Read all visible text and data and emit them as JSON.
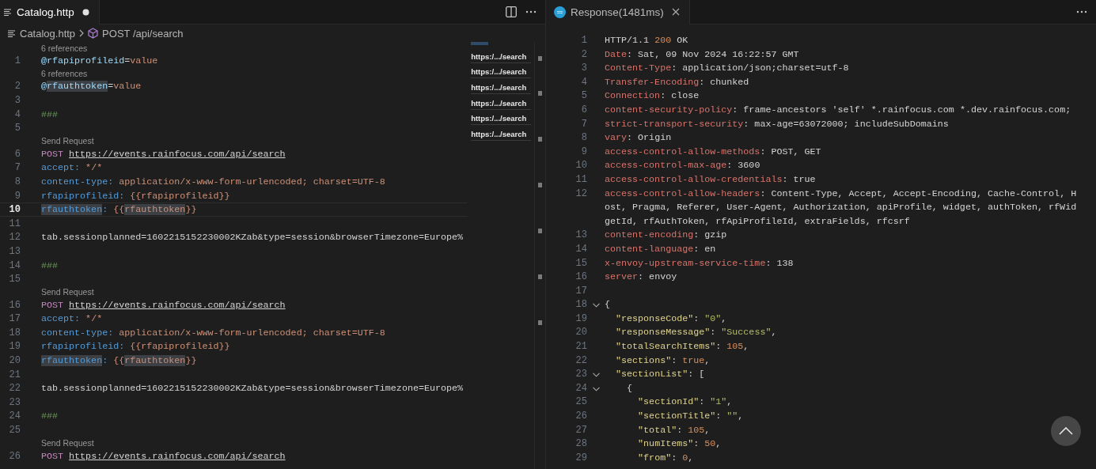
{
  "editor": {
    "tab": {
      "title": "Catalog.http",
      "modified": true
    },
    "breadcrumb": {
      "file": "Catalog.http",
      "symbol": "POST /api/search"
    },
    "lines": [
      {
        "kind": "lens",
        "text": "6 references"
      },
      {
        "kind": "code",
        "no": "1",
        "current": false,
        "tokens": [
          {
            "text": "@rfapiprofileid",
            "kind": "var"
          },
          {
            "text": "=",
            "kind": "plain"
          },
          {
            "text": "value",
            "kind": "val"
          }
        ]
      },
      {
        "kind": "lens",
        "text": "6 references"
      },
      {
        "kind": "code",
        "no": "2",
        "current": false,
        "tokens": [
          {
            "text": "@",
            "kind": "var"
          },
          {
            "text": "rfauthtoken",
            "kind": "var-hl"
          },
          {
            "text": "=",
            "kind": "plain"
          },
          {
            "text": "value",
            "kind": "val"
          }
        ]
      },
      {
        "kind": "code",
        "no": "3",
        "current": false
      },
      {
        "kind": "code",
        "no": "4",
        "current": false,
        "tokens": [
          {
            "text": "###",
            "kind": "comment"
          }
        ]
      },
      {
        "kind": "code",
        "no": "5",
        "current": false
      },
      {
        "kind": "lens",
        "text": "Send Request"
      },
      {
        "kind": "code",
        "no": "6",
        "current": false,
        "tokens": [
          {
            "text": "POST ",
            "kind": "method"
          },
          {
            "text": "https://events.rainfocus.com/api/search",
            "kind": "link"
          }
        ]
      },
      {
        "kind": "code",
        "no": "7",
        "current": false,
        "tokens": [
          {
            "text": "accept:",
            "kind": "header"
          },
          {
            "text": " */*",
            "kind": "val"
          }
        ]
      },
      {
        "kind": "code",
        "no": "8",
        "current": false,
        "tokens": [
          {
            "text": "content-type:",
            "kind": "header"
          },
          {
            "text": " application/x-www-form-urlencoded; charset=UTF-8",
            "kind": "val"
          }
        ]
      },
      {
        "kind": "code",
        "no": "9",
        "current": false,
        "tokens": [
          {
            "text": "rfapiprofileid:",
            "kind": "header"
          },
          {
            "text": " {{rfapiprofileid}}",
            "kind": "val"
          }
        ]
      },
      {
        "kind": "code",
        "no": "10",
        "current": true,
        "tokens": [
          {
            "text": "rfauthtoken",
            "kind": "header-hl"
          },
          {
            "text": ":",
            "kind": "header"
          },
          {
            "text": " {{",
            "kind": "val"
          },
          {
            "text": "rfauthtoken",
            "kind": "val-hl"
          },
          {
            "text": "}}",
            "kind": "val"
          }
        ]
      },
      {
        "kind": "code",
        "no": "11",
        "current": false
      },
      {
        "kind": "code",
        "no": "12",
        "current": false,
        "tokens": [
          {
            "text": "tab.sessionplanned=1602215152230002KZab&type=session&browserTimezone=Europe%",
            "kind": "plain"
          }
        ]
      },
      {
        "kind": "code",
        "no": "13",
        "current": false
      },
      {
        "kind": "code",
        "no": "14",
        "current": false,
        "tokens": [
          {
            "text": "###",
            "kind": "comment"
          }
        ]
      },
      {
        "kind": "code",
        "no": "15",
        "current": false
      },
      {
        "kind": "lens",
        "text": "Send Request"
      },
      {
        "kind": "code",
        "no": "16",
        "current": false,
        "tokens": [
          {
            "text": "POST ",
            "kind": "method"
          },
          {
            "text": "https://events.rainfocus.com/api/search",
            "kind": "link"
          }
        ]
      },
      {
        "kind": "code",
        "no": "17",
        "current": false,
        "tokens": [
          {
            "text": "accept:",
            "kind": "header"
          },
          {
            "text": " */*",
            "kind": "val"
          }
        ]
      },
      {
        "kind": "code",
        "no": "18",
        "current": false,
        "tokens": [
          {
            "text": "content-type:",
            "kind": "header"
          },
          {
            "text": " application/x-www-form-urlencoded; charset=UTF-8",
            "kind": "val"
          }
        ]
      },
      {
        "kind": "code",
        "no": "19",
        "current": false,
        "tokens": [
          {
            "text": "rfapiprofileid:",
            "kind": "header"
          },
          {
            "text": " {{rfapiprofileid}}",
            "kind": "val"
          }
        ]
      },
      {
        "kind": "code",
        "no": "20",
        "current": false,
        "tokens": [
          {
            "text": "rfauthtoken",
            "kind": "header-hl"
          },
          {
            "text": ":",
            "kind": "header"
          },
          {
            "text": " {{",
            "kind": "val"
          },
          {
            "text": "rfauthtoken",
            "kind": "val-hl"
          },
          {
            "text": "}}",
            "kind": "val"
          }
        ]
      },
      {
        "kind": "code",
        "no": "21",
        "current": false
      },
      {
        "kind": "code",
        "no": "22",
        "current": false,
        "tokens": [
          {
            "text": "tab.sessionplanned=1602215152230002KZab&type=session&browserTimezone=Europe%",
            "kind": "plain"
          }
        ]
      },
      {
        "kind": "code",
        "no": "23",
        "current": false
      },
      {
        "kind": "code",
        "no": "24",
        "current": false,
        "tokens": [
          {
            "text": "###",
            "kind": "comment"
          }
        ]
      },
      {
        "kind": "code",
        "no": "25",
        "current": false
      },
      {
        "kind": "lens",
        "text": "Send Request"
      },
      {
        "kind": "code",
        "no": "26",
        "current": false,
        "tokens": [
          {
            "text": "POST ",
            "kind": "method"
          },
          {
            "text": "https://events.rainfocus.com/api/search",
            "kind": "link"
          }
        ]
      }
    ],
    "minimap": {
      "labels": [
        "https:/.../search",
        "https:/.../search",
        "https:/.../search",
        "https:/.../search",
        "https:/.../search",
        "https:/.../search"
      ]
    }
  },
  "response": {
    "tab": {
      "title": "Response(1481ms)"
    },
    "lines": [
      {
        "no": "1",
        "fold": false,
        "tokens": [
          {
            "text": "HTTP/1.1 ",
            "kind": "plain"
          },
          {
            "text": "200",
            "kind": "num"
          },
          {
            "text": " OK",
            "kind": "plain"
          }
        ]
      },
      {
        "no": "2",
        "fold": false,
        "tokens": [
          {
            "text": "Date",
            "kind": "hname"
          },
          {
            "text": ": Sat, 09 Nov 2024 16:22:57 GMT",
            "kind": "plain"
          }
        ]
      },
      {
        "no": "3",
        "fold": false,
        "tokens": [
          {
            "text": "Content-Type",
            "kind": "hname"
          },
          {
            "text": ": application/json;charset=utf-8",
            "kind": "plain"
          }
        ]
      },
      {
        "no": "4",
        "fold": false,
        "tokens": [
          {
            "text": "Transfer-Encoding",
            "kind": "hname"
          },
          {
            "text": ": chunked",
            "kind": "plain"
          }
        ]
      },
      {
        "no": "5",
        "fold": false,
        "tokens": [
          {
            "text": "Connection",
            "kind": "hname"
          },
          {
            "text": ": close",
            "kind": "plain"
          }
        ]
      },
      {
        "no": "6",
        "fold": false,
        "tokens": [
          {
            "text": "content-security-policy",
            "kind": "hname"
          },
          {
            "text": ": frame-ancestors 'self' *.rainfocus.com *.dev.rainfocus.com;",
            "kind": "plain"
          }
        ]
      },
      {
        "no": "7",
        "fold": false,
        "tokens": [
          {
            "text": "strict-transport-security",
            "kind": "hname"
          },
          {
            "text": ": max-age=63072000; includeSubDomains",
            "kind": "plain"
          }
        ]
      },
      {
        "no": "8",
        "fold": false,
        "tokens": [
          {
            "text": "vary",
            "kind": "hname"
          },
          {
            "text": ": Origin",
            "kind": "plain"
          }
        ]
      },
      {
        "no": "9",
        "fold": false,
        "tokens": [
          {
            "text": "access-control-allow-methods",
            "kind": "hname"
          },
          {
            "text": ": POST, GET",
            "kind": "plain"
          }
        ]
      },
      {
        "no": "10",
        "fold": false,
        "tokens": [
          {
            "text": "access-control-max-age",
            "kind": "hname"
          },
          {
            "text": ": 3600",
            "kind": "plain"
          }
        ]
      },
      {
        "no": "11",
        "fold": false,
        "tokens": [
          {
            "text": "access-control-allow-credentials",
            "kind": "hname"
          },
          {
            "text": ": true",
            "kind": "plain"
          }
        ]
      },
      {
        "no": "12",
        "fold": false,
        "tokens": [
          {
            "text": "access-control-allow-headers",
            "kind": "hname"
          },
          {
            "text": ": Content-Type, Accept, Accept-Encoding, Cache-Control, Host, Pragma, Referer, User-Agent, Authorization, apiProfile, widget, authToken, rfWidgetId, rfAuthToken, rfApiProfileId, extraFields, rfcsrf",
            "kind": "plain"
          }
        ]
      },
      {
        "no": "13",
        "fold": false,
        "tokens": [
          {
            "text": "content-encoding",
            "kind": "hname"
          },
          {
            "text": ": gzip",
            "kind": "plain"
          }
        ]
      },
      {
        "no": "14",
        "fold": false,
        "tokens": [
          {
            "text": "content-language",
            "kind": "hname"
          },
          {
            "text": ": en",
            "kind": "plain"
          }
        ]
      },
      {
        "no": "15",
        "fold": false,
        "tokens": [
          {
            "text": "x-envoy-upstream-service-time",
            "kind": "hname"
          },
          {
            "text": ": 138",
            "kind": "plain"
          }
        ]
      },
      {
        "no": "16",
        "fold": false,
        "tokens": [
          {
            "text": "server",
            "kind": "hname"
          },
          {
            "text": ": envoy",
            "kind": "plain"
          }
        ]
      },
      {
        "no": "17",
        "fold": false
      },
      {
        "no": "18",
        "fold": true,
        "tokens": [
          {
            "text": "{",
            "kind": "plain"
          }
        ]
      },
      {
        "no": "19",
        "fold": false,
        "tokens": [
          {
            "text": "  \"responseCode\"",
            "kind": "key"
          },
          {
            "text": ": ",
            "kind": "plain"
          },
          {
            "text": "\"0\"",
            "kind": "str"
          },
          {
            "text": ",",
            "kind": "plain"
          }
        ]
      },
      {
        "no": "20",
        "fold": false,
        "tokens": [
          {
            "text": "  \"responseMessage\"",
            "kind": "key"
          },
          {
            "text": ": ",
            "kind": "plain"
          },
          {
            "text": "\"Success\"",
            "kind": "str"
          },
          {
            "text": ",",
            "kind": "plain"
          }
        ]
      },
      {
        "no": "21",
        "fold": false,
        "tokens": [
          {
            "text": "  \"totalSearchItems\"",
            "kind": "key"
          },
          {
            "text": ": ",
            "kind": "plain"
          },
          {
            "text": "105",
            "kind": "num"
          },
          {
            "text": ",",
            "kind": "plain"
          }
        ]
      },
      {
        "no": "22",
        "fold": false,
        "tokens": [
          {
            "text": "  \"sections\"",
            "kind": "key"
          },
          {
            "text": ": ",
            "kind": "plain"
          },
          {
            "text": "true",
            "kind": "num"
          },
          {
            "text": ",",
            "kind": "plain"
          }
        ]
      },
      {
        "no": "23",
        "fold": true,
        "tokens": [
          {
            "text": "  \"sectionList\"",
            "kind": "key"
          },
          {
            "text": ": [",
            "kind": "plain"
          }
        ]
      },
      {
        "no": "24",
        "fold": true,
        "tokens": [
          {
            "text": "    {",
            "kind": "plain"
          }
        ]
      },
      {
        "no": "25",
        "fold": false,
        "tokens": [
          {
            "text": "      \"sectionId\"",
            "kind": "key"
          },
          {
            "text": ": ",
            "kind": "plain"
          },
          {
            "text": "\"1\"",
            "kind": "str"
          },
          {
            "text": ",",
            "kind": "plain"
          }
        ]
      },
      {
        "no": "26",
        "fold": false,
        "tokens": [
          {
            "text": "      \"sectionTitle\"",
            "kind": "key"
          },
          {
            "text": ": ",
            "kind": "plain"
          },
          {
            "text": "\"\"",
            "kind": "str"
          },
          {
            "text": ",",
            "kind": "plain"
          }
        ]
      },
      {
        "no": "27",
        "fold": false,
        "tokens": [
          {
            "text": "      \"total\"",
            "kind": "key"
          },
          {
            "text": ": ",
            "kind": "plain"
          },
          {
            "text": "105",
            "kind": "num"
          },
          {
            "text": ",",
            "kind": "plain"
          }
        ]
      },
      {
        "no": "28",
        "fold": false,
        "tokens": [
          {
            "text": "      \"numItems\"",
            "kind": "key"
          },
          {
            "text": ": ",
            "kind": "plain"
          },
          {
            "text": "50",
            "kind": "num"
          },
          {
            "text": ",",
            "kind": "plain"
          }
        ]
      },
      {
        "no": "29",
        "fold": false,
        "tokens": [
          {
            "text": "      \"from\"",
            "kind": "key"
          },
          {
            "text": ": ",
            "kind": "plain"
          },
          {
            "text": "0",
            "kind": "num"
          },
          {
            "text": ",",
            "kind": "plain"
          }
        ]
      }
    ]
  }
}
